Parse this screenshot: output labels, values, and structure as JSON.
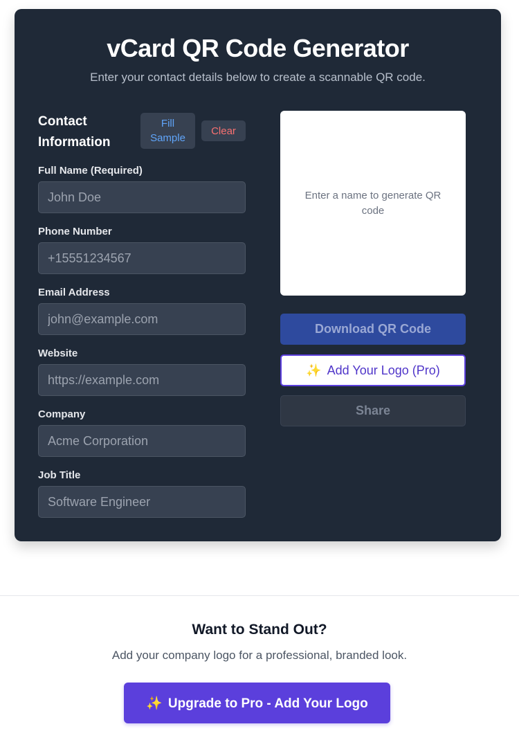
{
  "header": {
    "title": "vCard QR Code Generator",
    "subtitle": "Enter your contact details below to create a scannable QR code."
  },
  "form": {
    "section_title": "Contact Information",
    "fill_sample_label": "Fill Sample",
    "clear_label": "Clear",
    "fields": [
      {
        "label": "Full Name (Required)",
        "placeholder": "John Doe",
        "value": ""
      },
      {
        "label": "Phone Number",
        "placeholder": "+15551234567",
        "value": ""
      },
      {
        "label": "Email Address",
        "placeholder": "john@example.com",
        "value": ""
      },
      {
        "label": "Website",
        "placeholder": "https://example.com",
        "value": ""
      },
      {
        "label": "Company",
        "placeholder": "Acme Corporation",
        "value": ""
      },
      {
        "label": "Job Title",
        "placeholder": "Software Engineer",
        "value": ""
      }
    ]
  },
  "preview": {
    "placeholder_text": "Enter a name to generate QR code",
    "download_label": "Download QR Code",
    "logo_icon": "sparkles-icon",
    "logo_label": "Add Your Logo (Pro)",
    "share_label": "Share"
  },
  "promo": {
    "title": "Want to Stand Out?",
    "text": "Add your company logo for a professional, branded look.",
    "upgrade_icon": "sparkles-icon",
    "upgrade_label": "Upgrade to Pro - Add Your Logo"
  },
  "colors": {
    "card_bg": "#1f2937",
    "accent_purple": "#5b3fdc",
    "download_blue": "#2e4a9e",
    "fill_sample_text": "#60a5fa",
    "clear_text": "#f87171"
  }
}
